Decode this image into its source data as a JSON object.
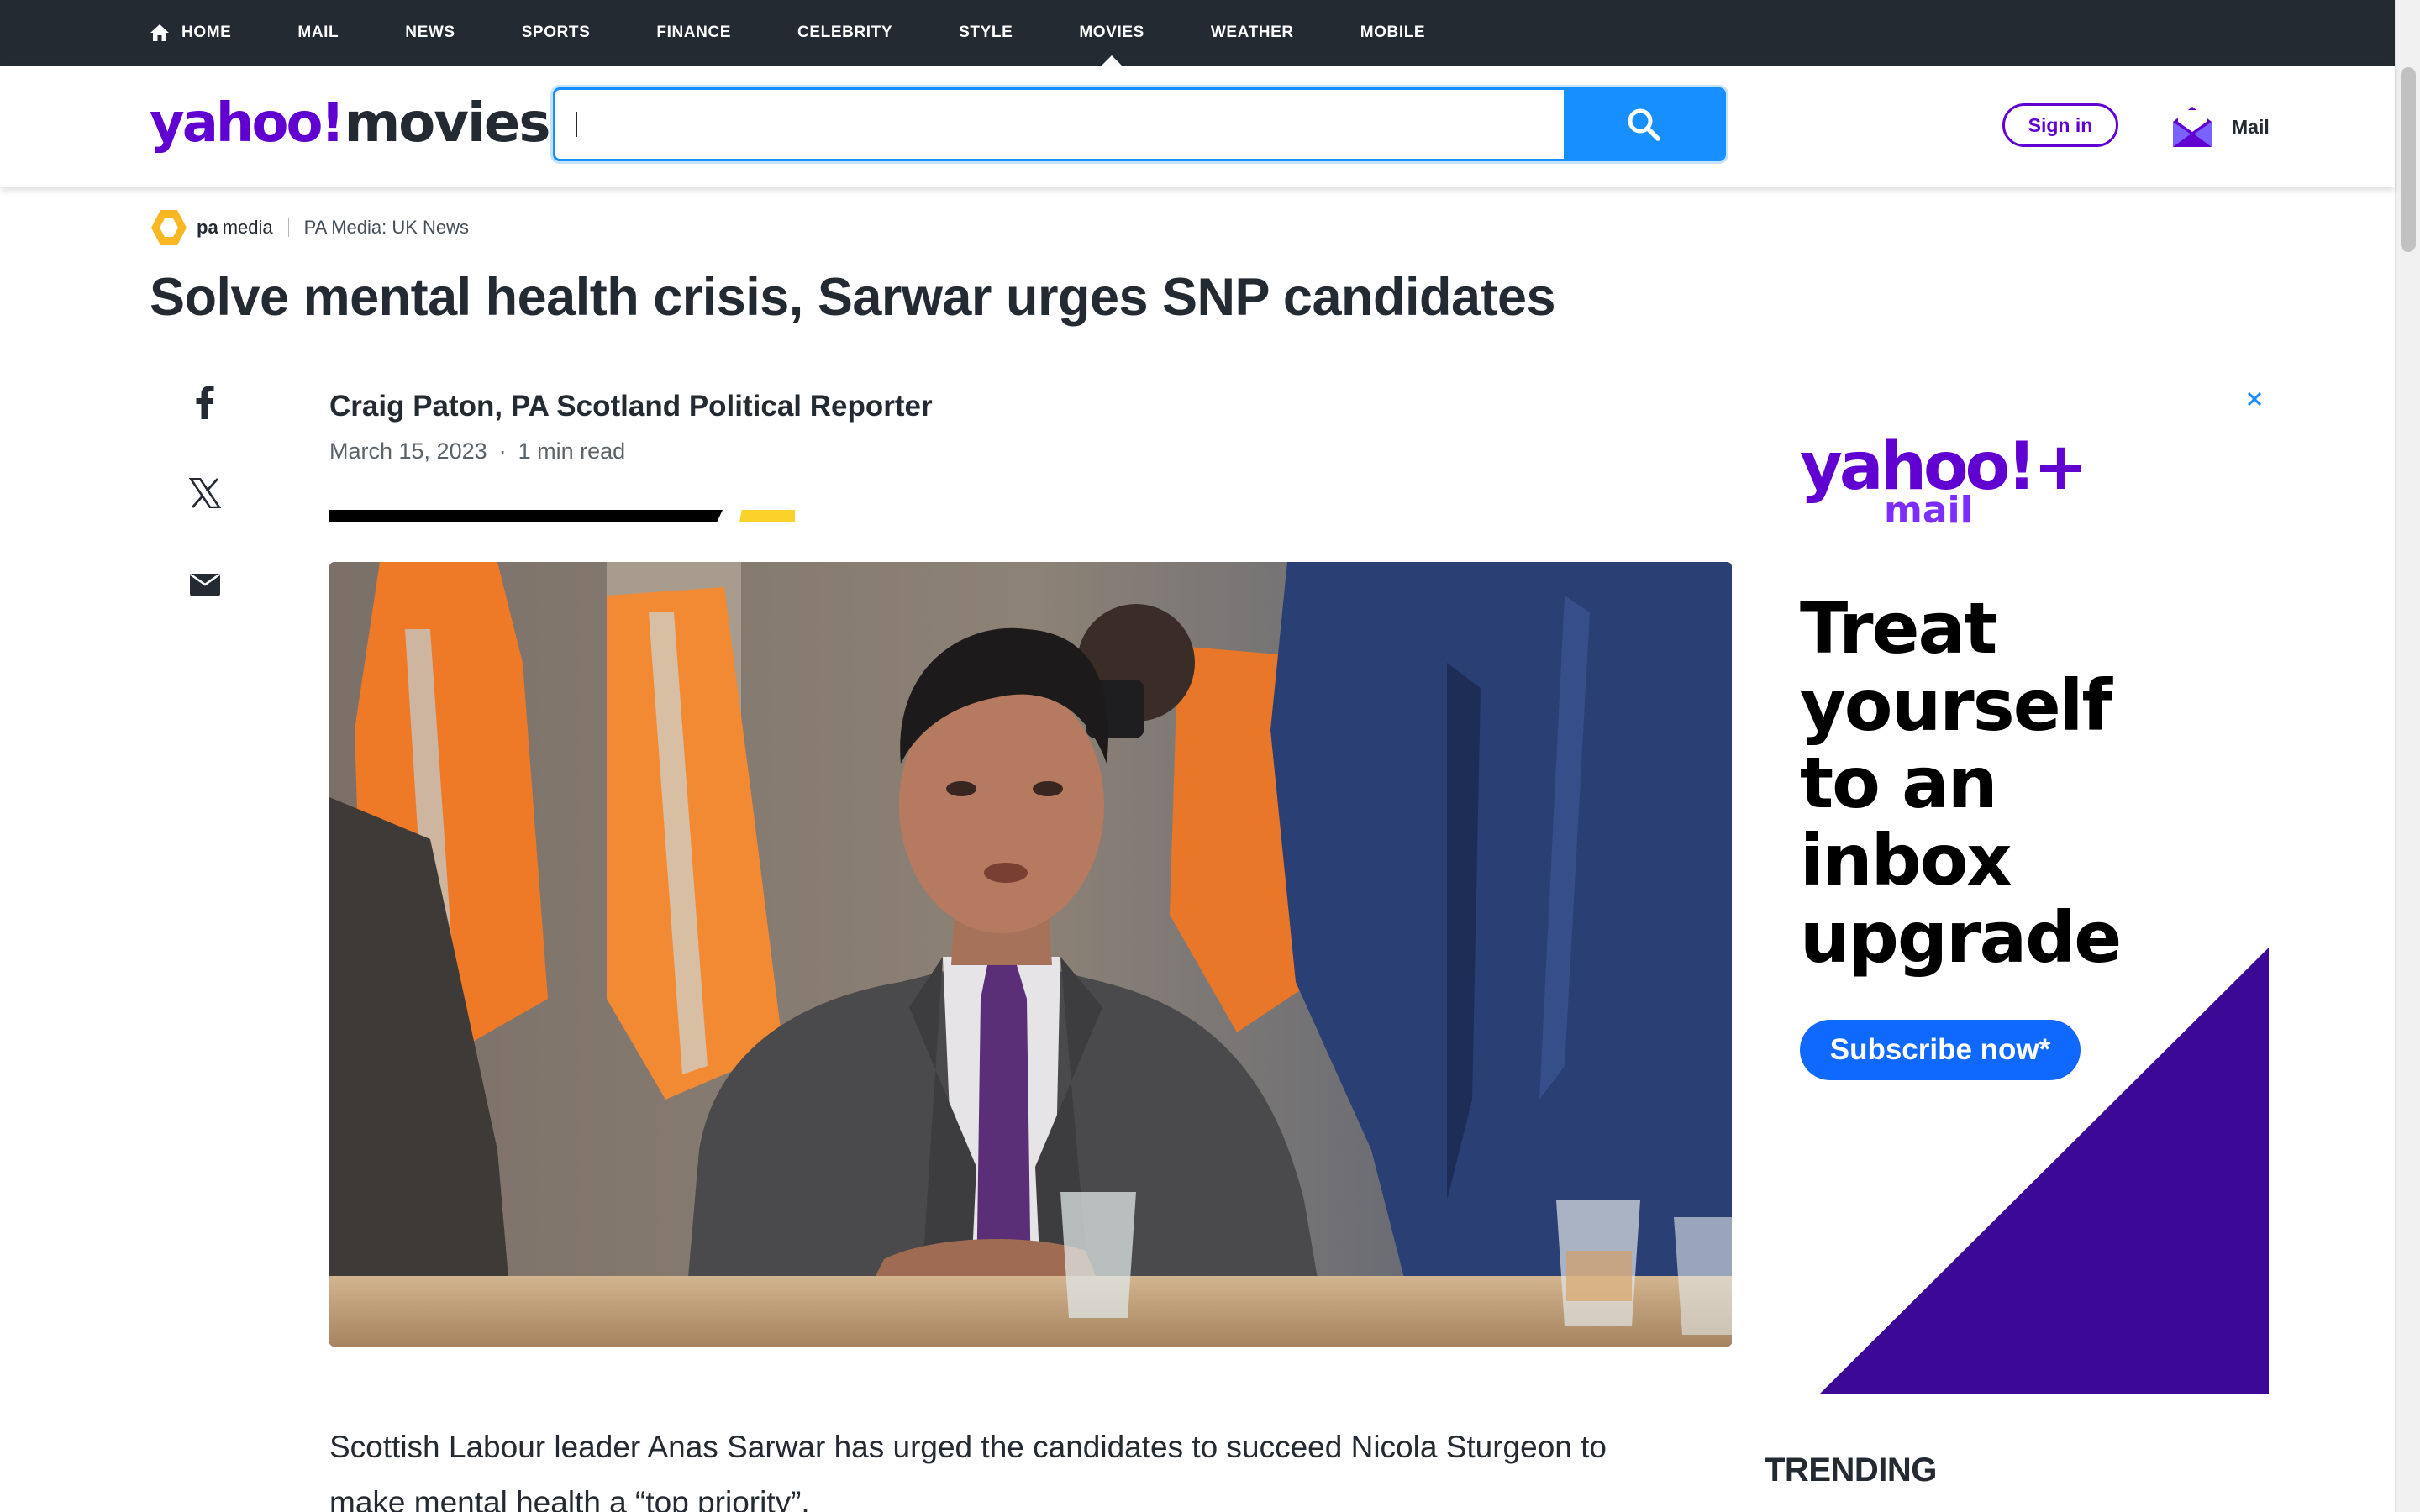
{
  "nav": {
    "items": [
      {
        "label": "HOME"
      },
      {
        "label": "MAIL"
      },
      {
        "label": "NEWS"
      },
      {
        "label": "SPORTS"
      },
      {
        "label": "FINANCE"
      },
      {
        "label": "CELEBRITY"
      },
      {
        "label": "STYLE"
      },
      {
        "label": "MOVIES",
        "active": true
      },
      {
        "label": "WEATHER"
      },
      {
        "label": "MOBILE"
      }
    ]
  },
  "header": {
    "logo_yahoo": "yahoo!",
    "logo_section": "movies",
    "search": {
      "value": "",
      "placeholder": ""
    },
    "signin_label": "Sign in",
    "mail_label": "Mail"
  },
  "article": {
    "provider_logo_bold": "pa",
    "provider_logo_light": "media",
    "provider_source": "PA Media: UK News",
    "headline": "Solve mental health crisis, Sarwar urges SNP candidates",
    "author": "Craig Paton, PA Scotland Political Reporter",
    "date": "March 15, 2023",
    "read_time": "1 min read",
    "meta_separator": "·",
    "body_paragraph": "Scottish Labour leader Anas Sarwar has urged the candidates to succeed Nicola Sturgeon to make mental health a “top priority”."
  },
  "ad": {
    "brand_yahoo": "yahoo!+",
    "brand_mail": "mail",
    "tagline": "Treat\nyourself\nto an\ninbox\nupgrade",
    "cta_label": "Subscribe now*"
  },
  "sidebar": {
    "trending_heading": "TRENDING"
  },
  "colors": {
    "nav_bg": "#232a31",
    "brand_purple": "#6001d2",
    "search_blue": "#188fff",
    "ad_purple": "#3c0896",
    "cta_blue": "#0f69ff",
    "divider_yellow": "#fcd12a"
  }
}
